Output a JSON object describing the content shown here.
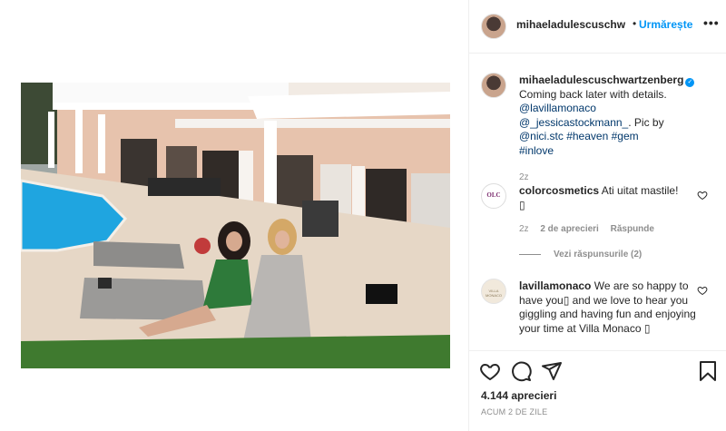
{
  "post": {
    "author": "mihaeladulescuschwartzenberg",
    "author_truncated": "mihaeladulescuschw",
    "follow_label": "Urmărește",
    "separator": "•",
    "more_label": "•••"
  },
  "caption": {
    "username": "mihaeladulescuschwartzenberg",
    "verified_glyph": "✓",
    "line1": "Coming back later with details.",
    "mention1": "@lavillamonaco",
    "mention2": "@_jessicastockmann_",
    "line2_prefix": ". Pic by ",
    "mention3": "@nici.stc",
    "tag1": "#heaven",
    "tag2": "#gem",
    "tag3": "#inlove",
    "age": "2z"
  },
  "comments": [
    {
      "username": "colorcosmetics",
      "text": "Ati uitat mastile! ",
      "emoji_box": "▯",
      "age": "2z",
      "likes": "2 de aprecieri",
      "reply_label": "Răspunde",
      "view_replies": "Vezi răspunsurile (2)",
      "avatar_text": "OLC"
    },
    {
      "username": "lavillamonaco",
      "text": "We are so happy to have you▯ and we love to hear you giggling and having fun and enjoying your time at Villa Monaco ▯",
      "avatar_text": "VILLA MONACO"
    }
  ],
  "footer": {
    "likes": "4.144 aprecieri",
    "time": "ACUM 2 DE ZILE"
  },
  "icons": {
    "like": "heart-icon",
    "comment": "comment-icon",
    "share": "paper-plane-icon",
    "save": "bookmark-icon"
  },
  "colors": {
    "link": "#00376b",
    "follow": "#0095f6",
    "muted": "#8e8e8e",
    "border": "#efefef"
  }
}
